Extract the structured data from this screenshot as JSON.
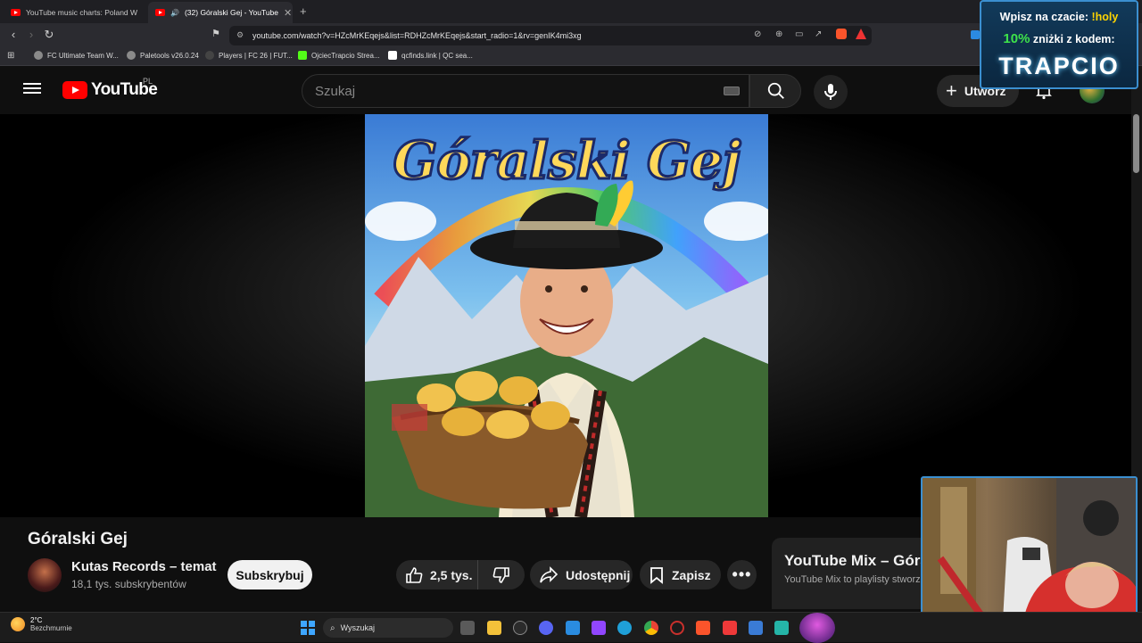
{
  "browser": {
    "tabs": [
      {
        "title": "YouTube music charts: Poland Week..."
      },
      {
        "title": "(32) Góralski Gej - YouTube"
      }
    ],
    "new_tab": "+",
    "url": "youtube.com/watch?v=HZcMrKEqejs&list=RDHZcMrKEqejs&start_radio=1&rv=genIK4mi3xg",
    "bookmarks": [
      {
        "label": "FC Ultimate Team W..."
      },
      {
        "label": "Paletools v26.0.24"
      },
      {
        "label": "Players | FC 26 | FUT..."
      },
      {
        "label": "OjciecTrapcio Strea..."
      },
      {
        "label": "qcfinds.link | QC sea..."
      }
    ]
  },
  "youtube": {
    "logo_text": "YouTube",
    "region": "PL",
    "search_placeholder": "Szukaj",
    "create_label": "Utwórz"
  },
  "video": {
    "title": "Góralski Gej",
    "thumbnail_text": "Góralski Gej",
    "channel_name": "Kutas Records – temat",
    "subscribers": "18,1 tys. subskrybentów",
    "subscribe_label": "Subskrybuj",
    "likes": "2,5 tys.",
    "share_label": "Udostępnij",
    "save_label": "Zapisz"
  },
  "mix": {
    "title": "YouTube Mix – Góralski Gej",
    "subtitle": "YouTube Mix to playlisty stworzone"
  },
  "promo": {
    "line1_prefix": "Wpisz na czacie:",
    "line1_cmd": "!holy",
    "line2_percent": "10%",
    "line2_suffix": "zniżki z kodem:",
    "code": "TRAPCIO"
  },
  "taskbar": {
    "temperature": "2°C",
    "weather": "Bezchmurnie",
    "search_label": "Wyszukaj"
  },
  "colors": {
    "youtube_red": "#ff0000",
    "background": "#0f0f0f",
    "promo_border": "#3b8fd0"
  }
}
